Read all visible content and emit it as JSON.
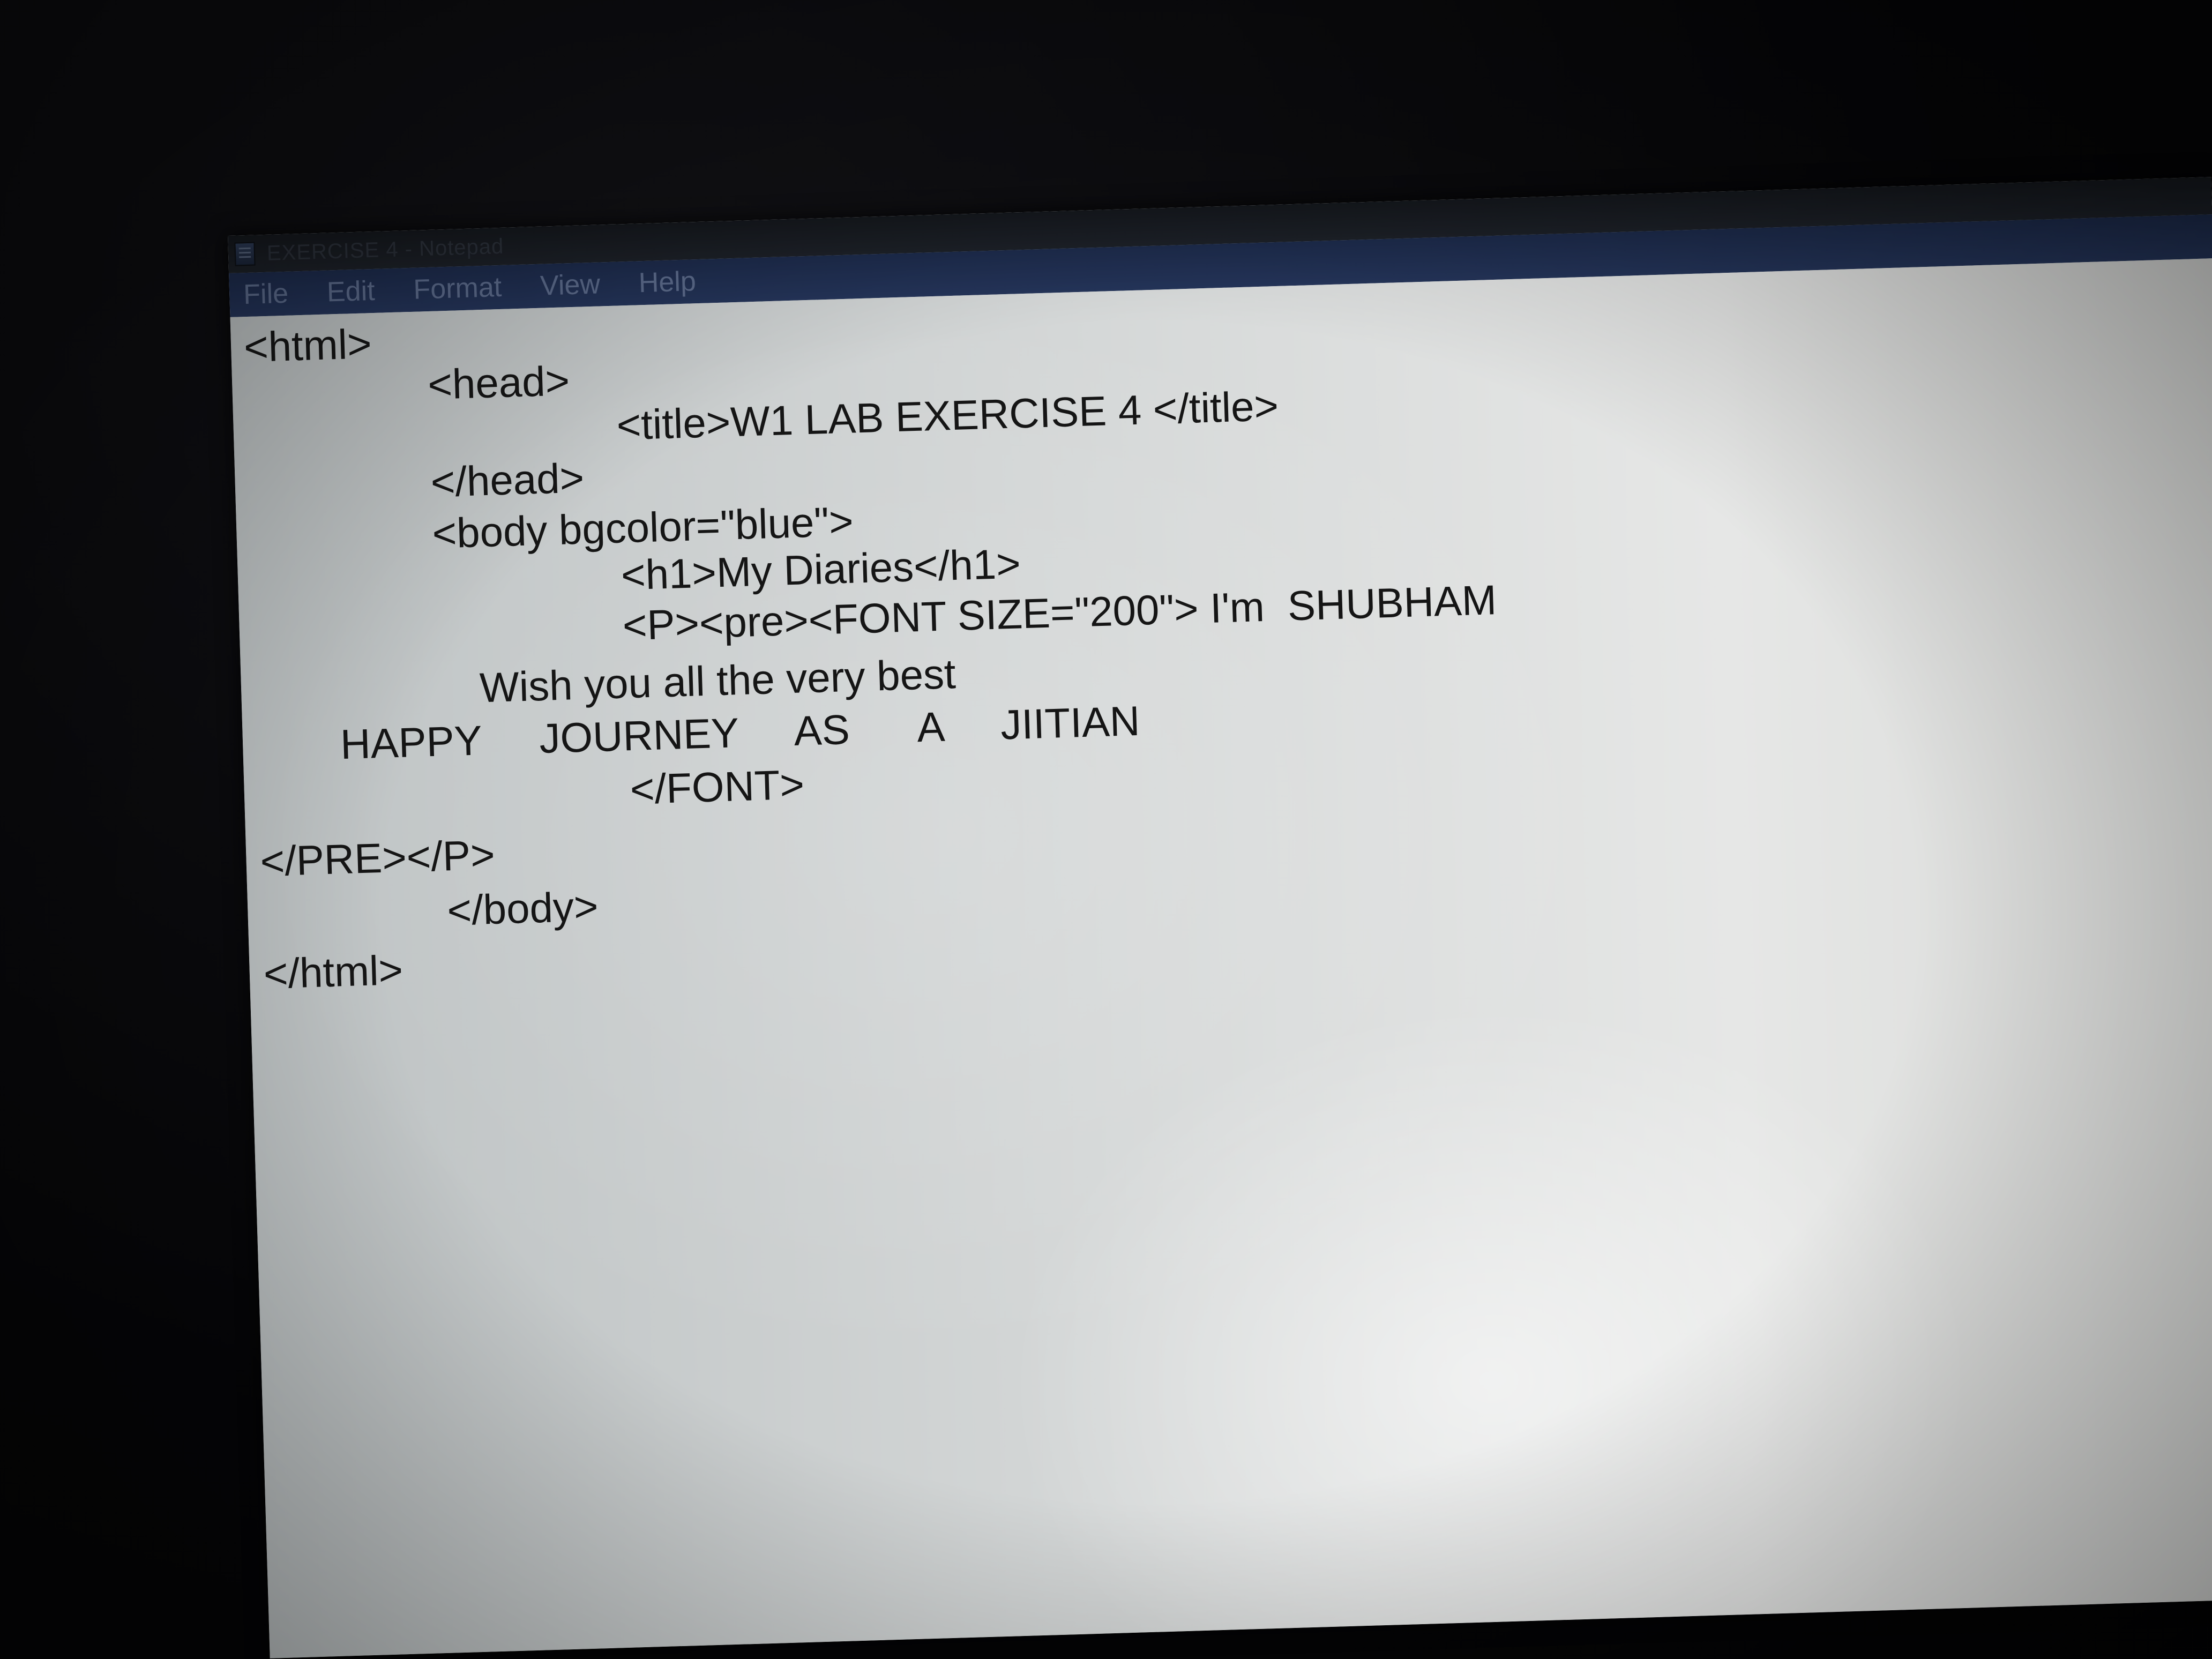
{
  "window": {
    "title": "EXERCISE 4 - Notepad"
  },
  "menu": {
    "items": [
      "File",
      "Edit",
      "Format",
      "View",
      "Help"
    ]
  },
  "editor": {
    "lines": [
      "<html>",
      "<head>",
      "<title>W1 LAB EXERCISE 4 </title>",
      "</head>",
      "<body bgcolor=\"blue\">",
      "<h1>My Diaries</h1>",
      "<P><pre><FONT SIZE=\"200\"> I'm  SHUBHAM",
      "Wish you all the very best",
      "HAPPY     JOURNEY     AS      A     JIITIAN",
      "</FONT>",
      "</PRE></P>",
      "</body>",
      "</html>"
    ]
  },
  "colors": {
    "menubar": "#243459",
    "titlebar": "#14171c",
    "editor_background": "#d3d6d6",
    "text": "#151515"
  },
  "icons": {
    "app": "notepad-icon"
  }
}
